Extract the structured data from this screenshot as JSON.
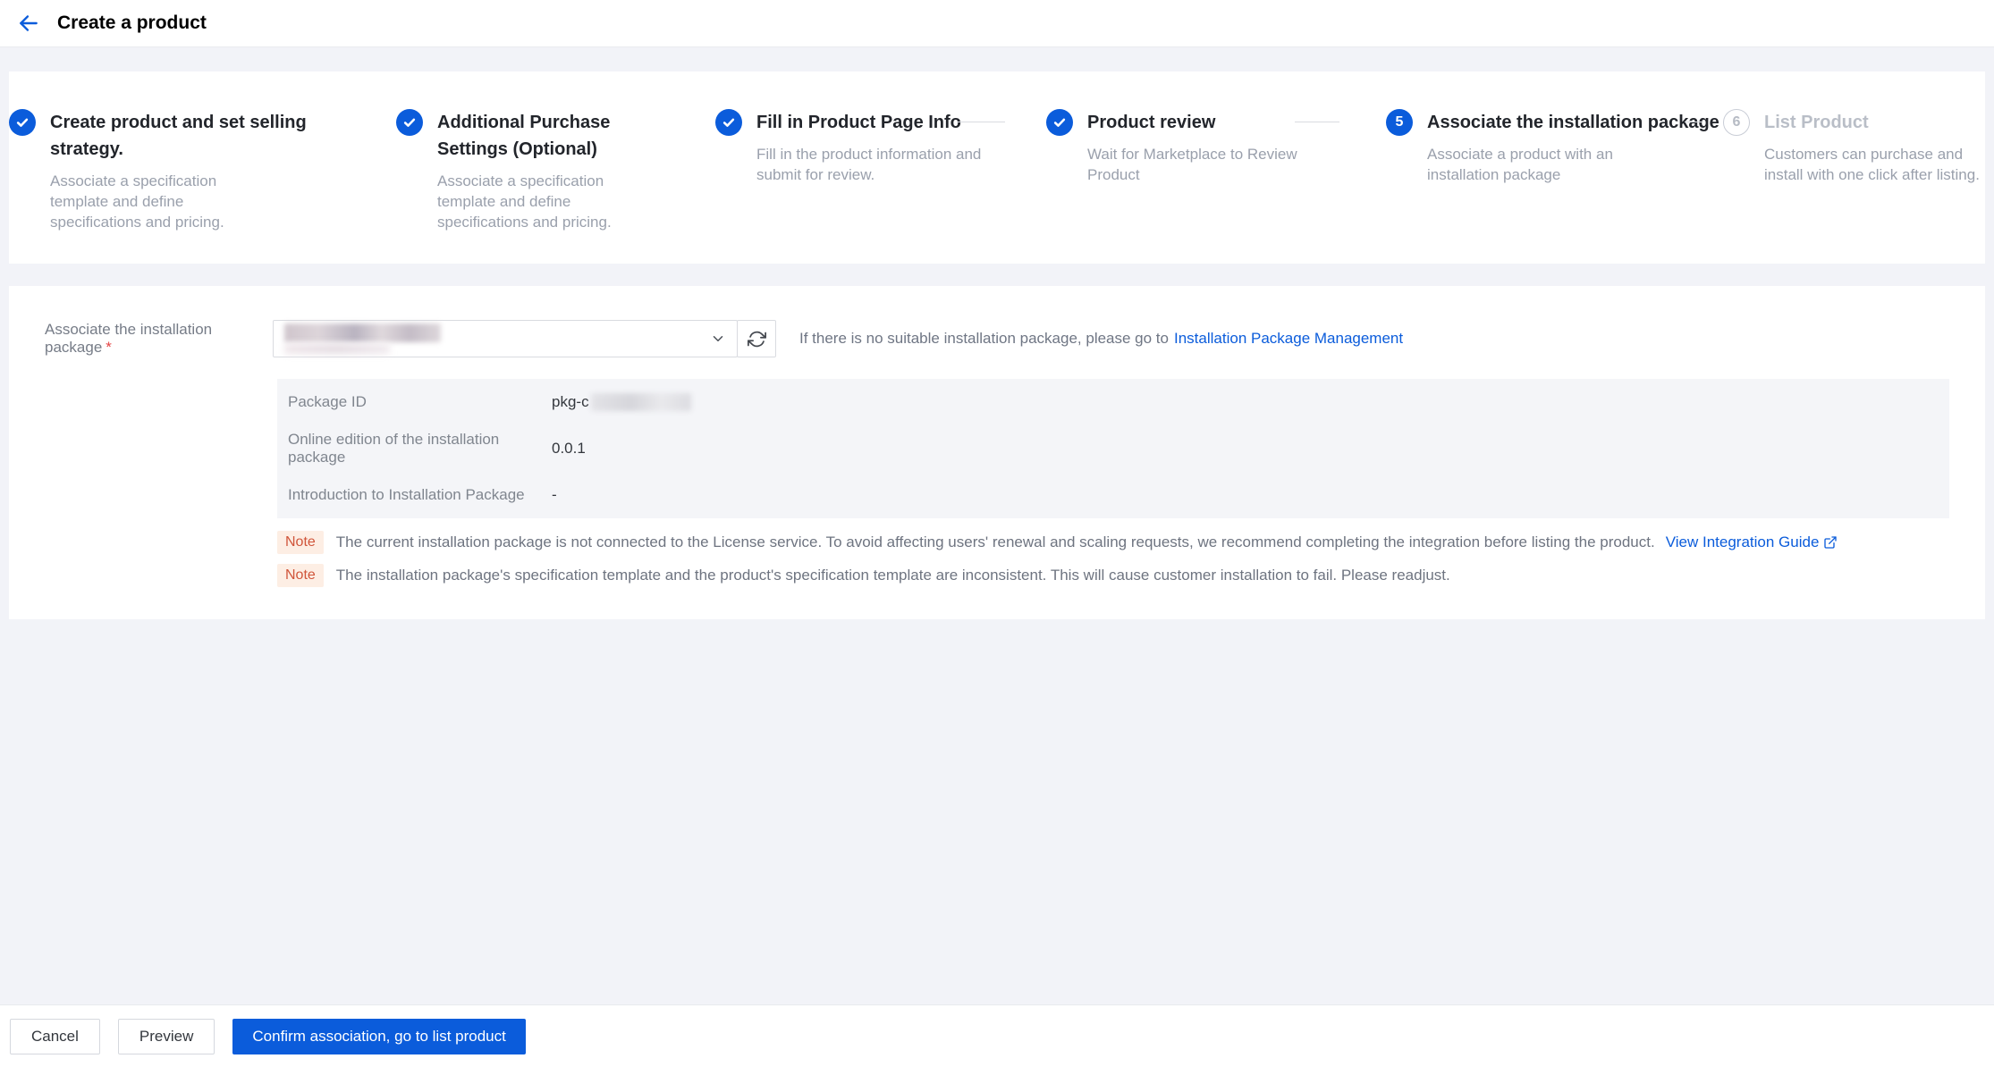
{
  "header": {
    "title": "Create a product"
  },
  "stepper": {
    "steps": [
      {
        "state": "done",
        "title": "Create product and set selling strategy.",
        "subtitle": "Associate a specification template and define specifications and pricing."
      },
      {
        "state": "done",
        "title": "Additional Purchase Settings (Optional)",
        "subtitle": "Associate a specification template and define specifications and pricing."
      },
      {
        "state": "done",
        "title": "Fill in Product Page Info",
        "subtitle": "Fill in the product information and submit for review."
      },
      {
        "state": "done",
        "title": "Product review",
        "subtitle": "Wait for Marketplace to Review Product"
      },
      {
        "state": "current",
        "number": "5",
        "title": "Associate the installation package",
        "subtitle": "Associate a product with an installation package"
      },
      {
        "state": "upcoming",
        "number": "6",
        "title": "List Product",
        "subtitle": "Customers can purchase and install with one click after listing."
      }
    ]
  },
  "form": {
    "field_label": "Associate the installation package",
    "required_mark": "*",
    "select": {
      "value_state": "redacted"
    },
    "help_text": "If there is no suitable installation package, please go to",
    "help_link": "Installation Package Management",
    "details": {
      "rows": [
        {
          "label": "Package ID",
          "value": "pkg-c",
          "value_redacted": true
        },
        {
          "label": "Online edition of the installation package",
          "value": "0.0.1"
        },
        {
          "label": "Introduction to Installation Package",
          "value": "-"
        }
      ]
    },
    "notes": [
      {
        "badge": "Note",
        "text": "The current installation package is not connected to the License service. To avoid affecting users' renewal and scaling requests, we recommend completing the integration before listing the product.",
        "link": "View Integration Guide"
      },
      {
        "badge": "Note",
        "text": "The installation package's specification template and the product's specification template are inconsistent. This will cause customer installation to fail. Please readjust."
      }
    ]
  },
  "footer": {
    "cancel_label": "Cancel",
    "preview_label": "Preview",
    "confirm_label": "Confirm association, go to list product"
  },
  "icons": {
    "back": "arrow-left",
    "step_done": "checkmark",
    "select_chevron": "chevron-down",
    "refresh": "refresh",
    "external_link": "external-link"
  },
  "colors": {
    "accent": "#0b5cdb",
    "link": "#0b5cdb",
    "page_bg": "#f2f3f8",
    "note_bg": "#fdeee4",
    "note_fg": "#d0553a"
  }
}
